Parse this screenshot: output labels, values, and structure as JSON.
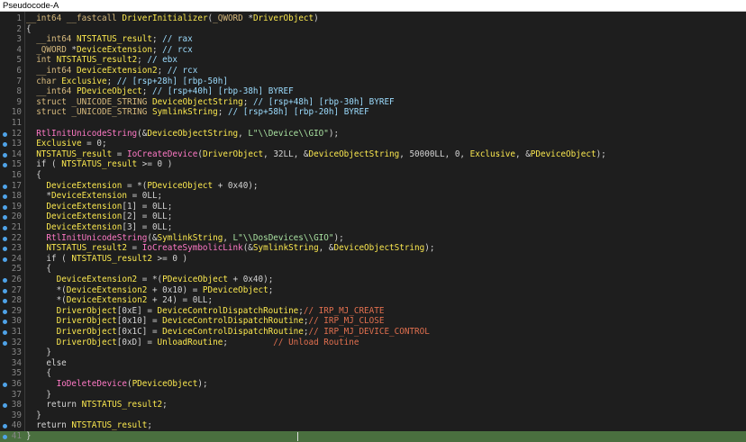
{
  "window": {
    "title": "Pseudocode-A"
  },
  "current_line": 41,
  "lines": [
    {
      "n": "1",
      "dot": false,
      "text": "__int64 __fastcall DriverInitializer(_QWORD *DriverObject)"
    },
    {
      "n": "2",
      "dot": false,
      "text": "{"
    },
    {
      "n": "3",
      "dot": false,
      "text": "  __int64 NTSTATUS_result; // rax"
    },
    {
      "n": "4",
      "dot": false,
      "text": "  _QWORD *DeviceExtension; // rcx"
    },
    {
      "n": "5",
      "dot": false,
      "text": "  int NTSTATUS_result2; // ebx"
    },
    {
      "n": "6",
      "dot": false,
      "text": "  __int64 DeviceExtension2; // rcx"
    },
    {
      "n": "7",
      "dot": false,
      "text": "  char Exclusive; // [rsp+28h] [rbp-50h]"
    },
    {
      "n": "8",
      "dot": false,
      "text": "  __int64 PDeviceObject; // [rsp+40h] [rbp-38h] BYREF"
    },
    {
      "n": "9",
      "dot": false,
      "text": "  struct _UNICODE_STRING DeviceObjectString; // [rsp+48h] [rbp-30h] BYREF"
    },
    {
      "n": "10",
      "dot": false,
      "text": "  struct _UNICODE_STRING SymlinkString; // [rsp+58h] [rbp-20h] BYREF"
    },
    {
      "n": "11",
      "dot": false,
      "text": ""
    },
    {
      "n": "12",
      "dot": true,
      "text": "  RtlInitUnicodeString(&DeviceObjectString, L\"\\\\Device\\\\GIO\");"
    },
    {
      "n": "13",
      "dot": true,
      "text": "  Exclusive = 0;"
    },
    {
      "n": "14",
      "dot": true,
      "text": "  NTSTATUS_result = IoCreateDevice(DriverObject, 32LL, &DeviceObjectString, 50000LL, 0, Exclusive, &PDeviceObject);"
    },
    {
      "n": "15",
      "dot": true,
      "text": "  if ( NTSTATUS_result >= 0 )"
    },
    {
      "n": "16",
      "dot": false,
      "text": "  {"
    },
    {
      "n": "17",
      "dot": true,
      "text": "    DeviceExtension = *(PDeviceObject + 0x40);"
    },
    {
      "n": "18",
      "dot": true,
      "text": "    *DeviceExtension = 0LL;"
    },
    {
      "n": "19",
      "dot": true,
      "text": "    DeviceExtension[1] = 0LL;"
    },
    {
      "n": "20",
      "dot": true,
      "text": "    DeviceExtension[2] = 0LL;"
    },
    {
      "n": "21",
      "dot": true,
      "text": "    DeviceExtension[3] = 0LL;"
    },
    {
      "n": "22",
      "dot": true,
      "text": "    RtlInitUnicodeString(&SymlinkString, L\"\\\\DosDevices\\\\GIO\");"
    },
    {
      "n": "23",
      "dot": true,
      "text": "    NTSTATUS_result2 = IoCreateSymbolicLink(&SymlinkString, &DeviceObjectString);"
    },
    {
      "n": "24",
      "dot": true,
      "text": "    if ( NTSTATUS_result2 >= 0 )"
    },
    {
      "n": "25",
      "dot": false,
      "text": "    {"
    },
    {
      "n": "26",
      "dot": true,
      "text": "      DeviceExtension2 = *(PDeviceObject + 0x40);"
    },
    {
      "n": "27",
      "dot": true,
      "text": "      *(DeviceExtension2 + 0x10) = PDeviceObject;"
    },
    {
      "n": "28",
      "dot": true,
      "text": "      *(DeviceExtension2 + 24) = 0LL;"
    },
    {
      "n": "29",
      "dot": true,
      "text": "      DriverObject[0xE] = DeviceControlDispatchRoutine;// IRP_MJ_CREATE"
    },
    {
      "n": "30",
      "dot": true,
      "text": "      DriverObject[0x10] = DeviceControlDispatchRoutine;// IRP_MJ_CLOSE"
    },
    {
      "n": "31",
      "dot": true,
      "text": "      DriverObject[0x1C] = DeviceControlDispatchRoutine;// IRP_MJ_DEVICE_CONTROL"
    },
    {
      "n": "32",
      "dot": true,
      "text": "      DriverObject[0xD] = UnloadRoutine;         // Unload Routine"
    },
    {
      "n": "33",
      "dot": false,
      "text": "    }"
    },
    {
      "n": "34",
      "dot": false,
      "text": "    else"
    },
    {
      "n": "35",
      "dot": false,
      "text": "    {"
    },
    {
      "n": "36",
      "dot": true,
      "text": "      IoDeleteDevice(PDeviceObject);"
    },
    {
      "n": "37",
      "dot": false,
      "text": "    }"
    },
    {
      "n": "38",
      "dot": true,
      "text": "    return NTSTATUS_result2;"
    },
    {
      "n": "39",
      "dot": false,
      "text": "  }"
    },
    {
      "n": "40",
      "dot": true,
      "text": "  return NTSTATUS_result;"
    },
    {
      "n": "41",
      "dot": true,
      "text": "}"
    }
  ]
}
